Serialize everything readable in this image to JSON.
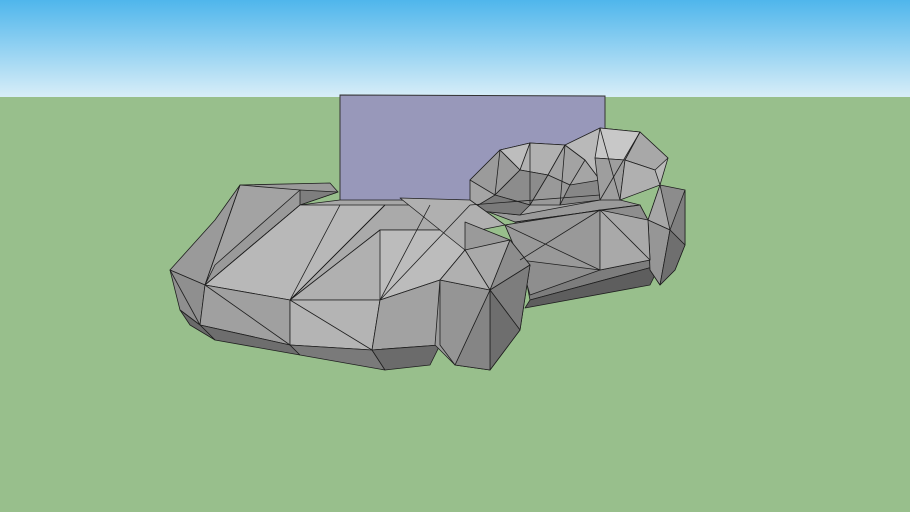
{
  "viewport": {
    "sky_top_color": "#4fb6ec",
    "sky_bottom_color": "#d9eef8",
    "ground_color": "#98bf8c",
    "model_face_color": "#8f8f8f",
    "model_light_face_color": "#b4b4b4",
    "model_dark_face_color": "#6f6f6f",
    "edge_color": "#1a1a1a",
    "plane_color": "#9898ba"
  }
}
